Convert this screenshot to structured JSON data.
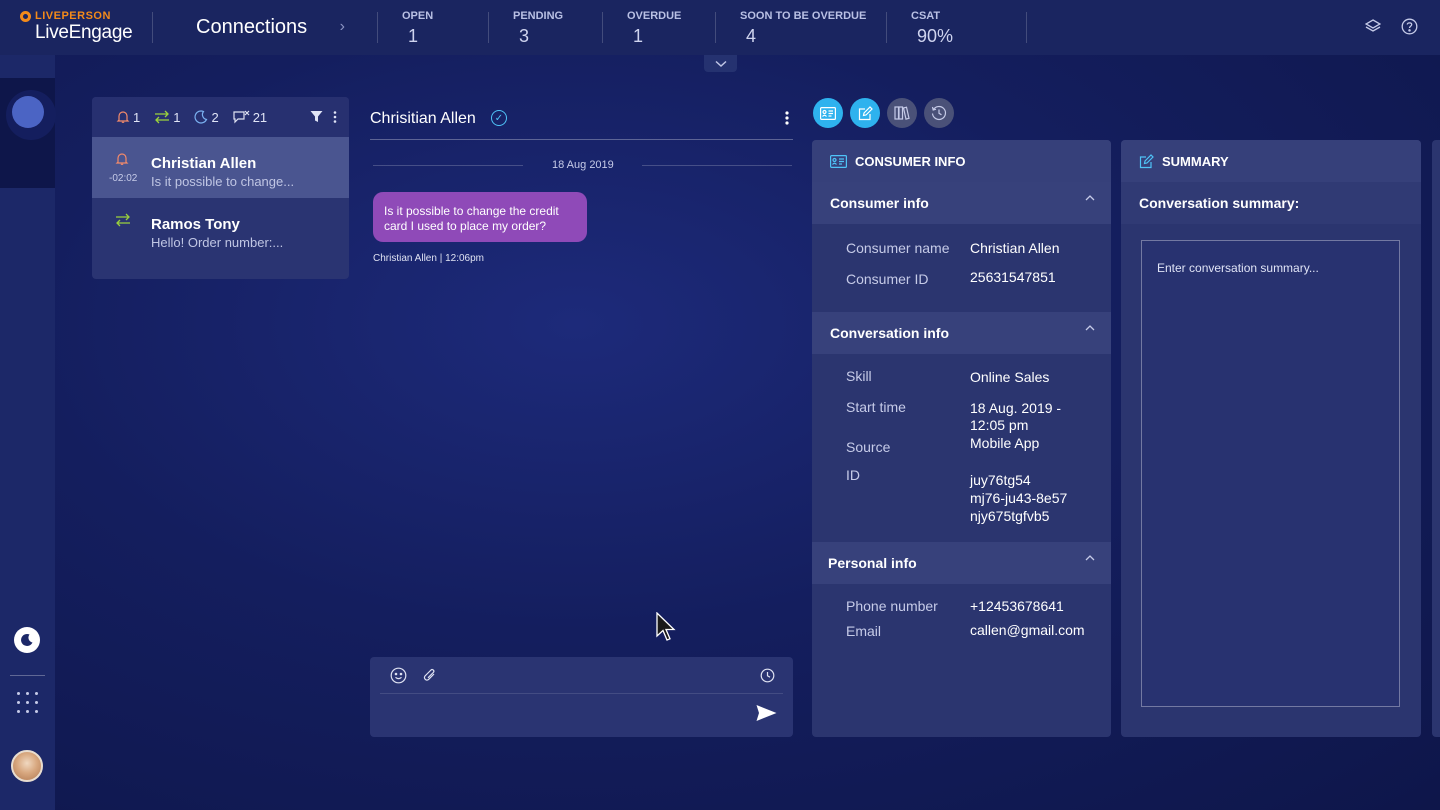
{
  "app": {
    "brand": "LIVEPERSON",
    "product": "LiveEngage"
  },
  "header": {
    "page_title": "Connections",
    "metrics": [
      {
        "label": "OPEN",
        "value": "1"
      },
      {
        "label": "PENDING",
        "value": "3"
      },
      {
        "label": "OVERDUE",
        "value": "1"
      },
      {
        "label": "SOON TO BE OVERDUE",
        "value": "4"
      },
      {
        "label": "CSAT",
        "value": "90%"
      }
    ],
    "icons": [
      "layers-icon",
      "help-icon"
    ]
  },
  "filters": [
    {
      "icon": "bell-icon",
      "count": "1",
      "color": "#f38a6a"
    },
    {
      "icon": "transfer-icon",
      "count": "1",
      "color": "#9bd23c"
    },
    {
      "icon": "moon-icon",
      "count": "2",
      "color": "#7ab0f0"
    },
    {
      "icon": "chat-closed-icon",
      "count": "21",
      "color": "#dfe2f2"
    }
  ],
  "conversations": [
    {
      "name": "Christian Allen",
      "preview": "Is it possible to change...",
      "timer": "-02:02",
      "icon": "bell-icon",
      "active": true
    },
    {
      "name": "Ramos Tony",
      "preview": "Hello! Order number:...",
      "icon": "transfer-icon",
      "active": false
    }
  ],
  "chat": {
    "title": "Chrisitian Allen",
    "date": "18 Aug 2019",
    "message": "Is it possible to change the credit card I used to place my order?",
    "meta": "Christian Allen | 12:06pm"
  },
  "consumer_panel": {
    "title": "CONSUMER INFO",
    "sections": {
      "consumer": {
        "title": "Consumer info",
        "name_label": "Consumer name",
        "name": "Christian Allen",
        "id_label": "Consumer ID",
        "id": "25631547851"
      },
      "conversation": {
        "title": "Conversation info",
        "skill_label": "Skill",
        "skill": "Online Sales",
        "start_label": "Start time",
        "start_line1": "18 Aug. 2019 -",
        "start_line2": "12:05 pm",
        "source_label": "Source",
        "source": "Mobile App",
        "id_label": "ID",
        "id_line1": "juy76tg54",
        "id_line2": "mj76-ju43-8e57",
        "id_line3": "njy675tgfvb5"
      },
      "personal": {
        "title": "Personal info",
        "phone_label": "Phone number",
        "phone": "+12453678641",
        "email_label": "Email",
        "email": "callen@gmail.com"
      }
    }
  },
  "summary_panel": {
    "title": "SUMMARY",
    "subtitle": "Conversation summary:",
    "placeholder": "Enter conversation summary..."
  },
  "colors": {
    "accent": "#2eb2ee",
    "bubble": "#8f4ab8",
    "brand": "#f38a1a"
  }
}
